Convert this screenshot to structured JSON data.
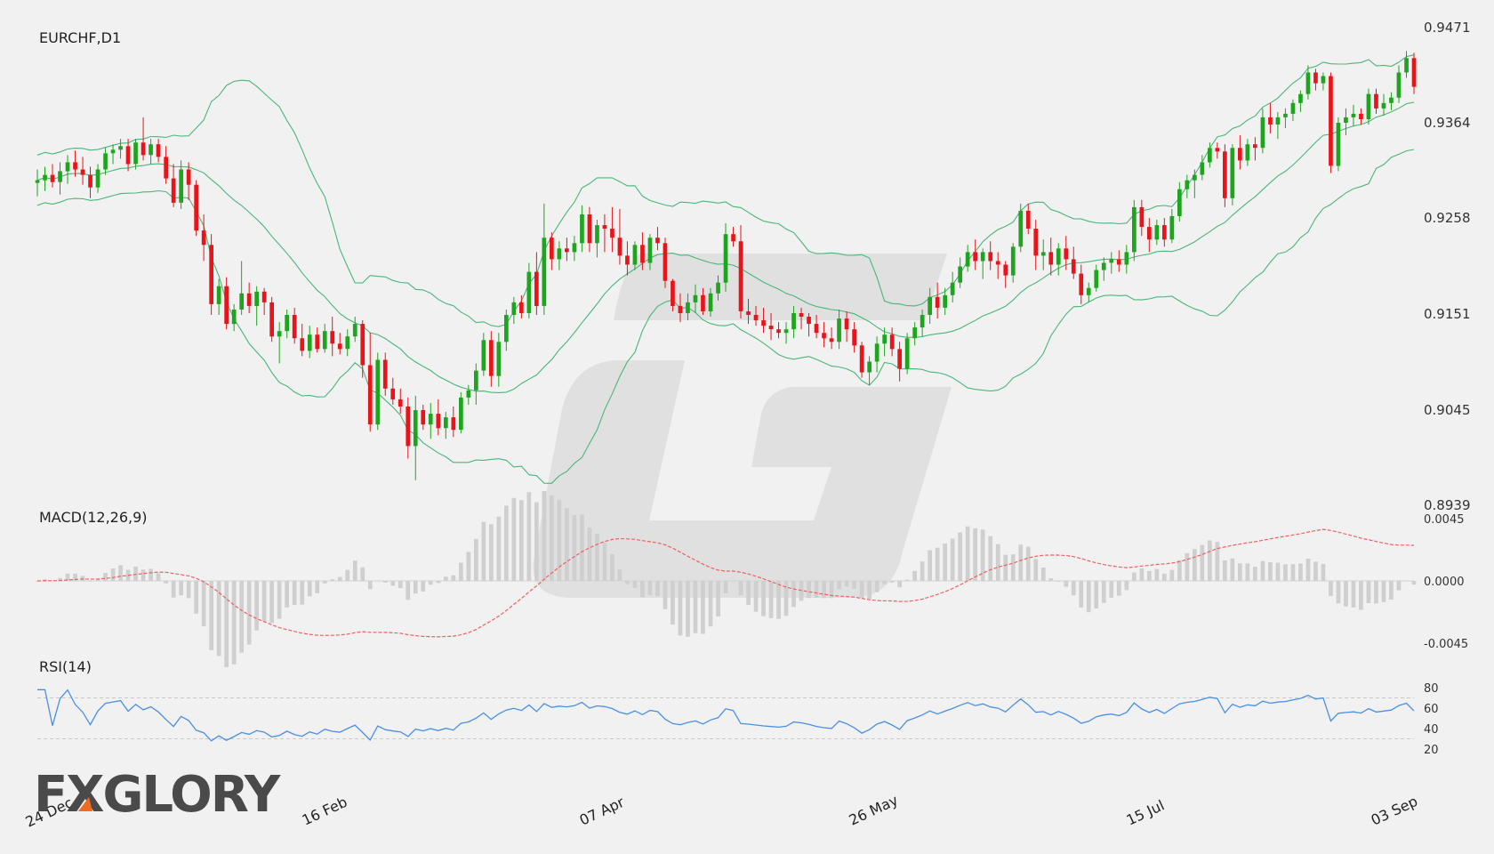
{
  "chart_data": [
    {
      "type": "candlestick",
      "title": "EURCHF,D1",
      "ylim": [
        0.8939,
        0.9471
      ],
      "y_ticks": [
        "0.9471",
        "0.9364",
        "0.9258",
        "0.9151",
        "0.9045",
        "0.8939"
      ],
      "x_tick_labels": [
        "24 Dec",
        "16 Feb",
        "07 Apr",
        "26 May",
        "15 Jul",
        "03 Sep"
      ],
      "bollinger_bands": true,
      "colors": {
        "up": "#1ea51e",
        "down": "#e8141a",
        "band": "#4ab67a"
      },
      "ohlc": [
        [
          0.9297,
          0.9312,
          0.9282,
          0.93
        ],
        [
          0.93,
          0.9315,
          0.9288,
          0.9306
        ],
        [
          0.9306,
          0.9318,
          0.9292,
          0.9298
        ],
        [
          0.9298,
          0.932,
          0.9284,
          0.931
        ],
        [
          0.931,
          0.9328,
          0.9296,
          0.932
        ],
        [
          0.932,
          0.9333,
          0.9304,
          0.9312
        ],
        [
          0.9312,
          0.9326,
          0.9295,
          0.9306
        ],
        [
          0.9306,
          0.9315,
          0.928,
          0.9292
        ],
        [
          0.9292,
          0.9318,
          0.9286,
          0.9312
        ],
        [
          0.9312,
          0.9336,
          0.9306,
          0.933
        ],
        [
          0.933,
          0.934,
          0.9318,
          0.9334
        ],
        [
          0.9334,
          0.9346,
          0.9324,
          0.9338
        ],
        [
          0.9338,
          0.9346,
          0.931,
          0.9318
        ],
        [
          0.9318,
          0.9346,
          0.9312,
          0.9342
        ],
        [
          0.9342,
          0.937,
          0.9322,
          0.9328
        ],
        [
          0.9328,
          0.9346,
          0.9318,
          0.934
        ],
        [
          0.934,
          0.9346,
          0.932,
          0.9326
        ],
        [
          0.9326,
          0.9338,
          0.9296,
          0.9302
        ],
        [
          0.9302,
          0.9318,
          0.927,
          0.9275
        ],
        [
          0.9275,
          0.9322,
          0.9268,
          0.9312
        ],
        [
          0.9312,
          0.932,
          0.9278,
          0.9295
        ],
        [
          0.9295,
          0.93,
          0.9238,
          0.9244
        ],
        [
          0.9244,
          0.9262,
          0.921,
          0.9228
        ],
        [
          0.9228,
          0.924,
          0.915,
          0.9162
        ],
        [
          0.9162,
          0.919,
          0.915,
          0.9182
        ],
        [
          0.9182,
          0.9192,
          0.9134,
          0.914
        ],
        [
          0.914,
          0.9162,
          0.9132,
          0.9156
        ],
        [
          0.9156,
          0.921,
          0.915,
          0.9174
        ],
        [
          0.9174,
          0.9186,
          0.9152,
          0.916
        ],
        [
          0.916,
          0.9182,
          0.9138,
          0.9176
        ],
        [
          0.9176,
          0.918,
          0.915,
          0.9164
        ],
        [
          0.9164,
          0.917,
          0.912,
          0.9126
        ],
        [
          0.9126,
          0.9142,
          0.9096,
          0.9132
        ],
        [
          0.9132,
          0.9156,
          0.9124,
          0.915
        ],
        [
          0.915,
          0.9158,
          0.9118,
          0.9124
        ],
        [
          0.9124,
          0.914,
          0.9104,
          0.911
        ],
        [
          0.911,
          0.9138,
          0.9102,
          0.9128
        ],
        [
          0.9128,
          0.9136,
          0.9108,
          0.9112
        ],
        [
          0.9112,
          0.914,
          0.9108,
          0.9132
        ],
        [
          0.9132,
          0.9148,
          0.9104,
          0.9118
        ],
        [
          0.9118,
          0.913,
          0.9106,
          0.9112
        ],
        [
          0.9112,
          0.9134,
          0.9104,
          0.9126
        ],
        [
          0.9126,
          0.9148,
          0.912,
          0.914
        ],
        [
          0.914,
          0.9144,
          0.908,
          0.9094
        ],
        [
          0.9094,
          0.913,
          0.902,
          0.9028
        ],
        [
          0.9028,
          0.9108,
          0.9022,
          0.91
        ],
        [
          0.91,
          0.9108,
          0.906,
          0.9068
        ],
        [
          0.9068,
          0.908,
          0.905,
          0.9056
        ],
        [
          0.9056,
          0.9068,
          0.904,
          0.9048
        ],
        [
          0.9048,
          0.9058,
          0.899,
          0.9004
        ],
        [
          0.9004,
          0.906,
          0.8966,
          0.9044
        ],
        [
          0.9044,
          0.905,
          0.9022,
          0.9028
        ],
        [
          0.9028,
          0.9052,
          0.9012,
          0.904
        ],
        [
          0.904,
          0.9056,
          0.9016,
          0.9024
        ],
        [
          0.9024,
          0.9042,
          0.9012,
          0.9036
        ],
        [
          0.9036,
          0.9048,
          0.9014,
          0.9022
        ],
        [
          0.9022,
          0.9064,
          0.9018,
          0.9058
        ],
        [
          0.9058,
          0.9072,
          0.905,
          0.9066
        ],
        [
          0.9066,
          0.9096,
          0.905,
          0.9088
        ],
        [
          0.9088,
          0.913,
          0.9082,
          0.9122
        ],
        [
          0.9122,
          0.9132,
          0.907,
          0.9082
        ],
        [
          0.9082,
          0.913,
          0.907,
          0.912
        ],
        [
          0.912,
          0.9156,
          0.911,
          0.915
        ],
        [
          0.915,
          0.917,
          0.914,
          0.9164
        ],
        [
          0.9164,
          0.9172,
          0.9146,
          0.9152
        ],
        [
          0.9152,
          0.9208,
          0.9146,
          0.9198
        ],
        [
          0.9198,
          0.922,
          0.915,
          0.916
        ],
        [
          0.916,
          0.9274,
          0.915,
          0.9236
        ],
        [
          0.9236,
          0.9242,
          0.92,
          0.9212
        ],
        [
          0.9212,
          0.9232,
          0.92,
          0.9224
        ],
        [
          0.9224,
          0.9236,
          0.921,
          0.922
        ],
        [
          0.922,
          0.9238,
          0.921,
          0.923
        ],
        [
          0.923,
          0.9272,
          0.922,
          0.9262
        ],
        [
          0.9262,
          0.927,
          0.922,
          0.923
        ],
        [
          0.923,
          0.9256,
          0.9214,
          0.925
        ],
        [
          0.925,
          0.9262,
          0.922,
          0.9246
        ],
        [
          0.9246,
          0.927,
          0.922,
          0.9236
        ],
        [
          0.9236,
          0.9268,
          0.9206,
          0.9216
        ],
        [
          0.9216,
          0.9232,
          0.9194,
          0.9206
        ],
        [
          0.9206,
          0.9232,
          0.92,
          0.9228
        ],
        [
          0.9228,
          0.9242,
          0.92,
          0.9208
        ],
        [
          0.9208,
          0.924,
          0.92,
          0.9236
        ],
        [
          0.9236,
          0.9248,
          0.9222,
          0.923
        ],
        [
          0.923,
          0.9236,
          0.918,
          0.9188
        ],
        [
          0.9188,
          0.919,
          0.9154,
          0.916
        ],
        [
          0.916,
          0.9174,
          0.9142,
          0.9152
        ],
        [
          0.9152,
          0.9174,
          0.9144,
          0.9164
        ],
        [
          0.9164,
          0.9184,
          0.9152,
          0.9172
        ],
        [
          0.9172,
          0.918,
          0.915,
          0.9154
        ],
        [
          0.9154,
          0.918,
          0.9148,
          0.9174
        ],
        [
          0.9174,
          0.9194,
          0.9166,
          0.9186
        ],
        [
          0.9186,
          0.9252,
          0.9176,
          0.924
        ],
        [
          0.924,
          0.9248,
          0.9226,
          0.9232
        ],
        [
          0.9232,
          0.925,
          0.9146,
          0.9154
        ],
        [
          0.9154,
          0.9168,
          0.914,
          0.915
        ],
        [
          0.915,
          0.916,
          0.9138,
          0.9144
        ],
        [
          0.9144,
          0.9158,
          0.913,
          0.9138
        ],
        [
          0.9138,
          0.9152,
          0.9122,
          0.9134
        ],
        [
          0.9134,
          0.9142,
          0.9124,
          0.913
        ],
        [
          0.913,
          0.9142,
          0.9118,
          0.9134
        ],
        [
          0.9134,
          0.916,
          0.9124,
          0.9152
        ],
        [
          0.9152,
          0.9158,
          0.9134,
          0.9148
        ],
        [
          0.9148,
          0.9152,
          0.9126,
          0.914
        ],
        [
          0.914,
          0.915,
          0.9124,
          0.913
        ],
        [
          0.913,
          0.9142,
          0.9114,
          0.9124
        ],
        [
          0.9124,
          0.9136,
          0.9112,
          0.912
        ],
        [
          0.912,
          0.9156,
          0.9112,
          0.9146
        ],
        [
          0.9146,
          0.9154,
          0.912,
          0.9134
        ],
        [
          0.9134,
          0.9142,
          0.9108,
          0.9116
        ],
        [
          0.9116,
          0.912,
          0.908,
          0.9086
        ],
        [
          0.9086,
          0.9104,
          0.9072,
          0.9098
        ],
        [
          0.9098,
          0.9126,
          0.9086,
          0.9118
        ],
        [
          0.9118,
          0.9136,
          0.9104,
          0.9128
        ],
        [
          0.9128,
          0.9136,
          0.9104,
          0.9112
        ],
        [
          0.9112,
          0.912,
          0.9076,
          0.909
        ],
        [
          0.909,
          0.913,
          0.9084,
          0.9124
        ],
        [
          0.9124,
          0.9142,
          0.9116,
          0.9136
        ],
        [
          0.9136,
          0.9156,
          0.9126,
          0.915
        ],
        [
          0.915,
          0.918,
          0.914,
          0.917
        ],
        [
          0.917,
          0.9186,
          0.9146,
          0.9158
        ],
        [
          0.9158,
          0.918,
          0.915,
          0.9172
        ],
        [
          0.9172,
          0.9198,
          0.9164,
          0.9186
        ],
        [
          0.9186,
          0.9214,
          0.918,
          0.9204
        ],
        [
          0.9204,
          0.9228,
          0.9198,
          0.922
        ],
        [
          0.922,
          0.9234,
          0.92,
          0.921
        ],
        [
          0.921,
          0.9224,
          0.919,
          0.922
        ],
        [
          0.922,
          0.9232,
          0.92,
          0.921
        ],
        [
          0.921,
          0.922,
          0.919,
          0.9206
        ],
        [
          0.9206,
          0.921,
          0.918,
          0.9194
        ],
        [
          0.9194,
          0.923,
          0.9186,
          0.9226
        ],
        [
          0.9226,
          0.9274,
          0.922,
          0.9266
        ],
        [
          0.9266,
          0.9274,
          0.924,
          0.9246
        ],
        [
          0.9246,
          0.9256,
          0.92,
          0.9216
        ],
        [
          0.9216,
          0.9234,
          0.92,
          0.922
        ],
        [
          0.922,
          0.9236,
          0.9194,
          0.9206
        ],
        [
          0.9206,
          0.923,
          0.9194,
          0.9224
        ],
        [
          0.9224,
          0.9238,
          0.92,
          0.9212
        ],
        [
          0.9212,
          0.9226,
          0.919,
          0.9196
        ],
        [
          0.9196,
          0.9206,
          0.9162,
          0.9172
        ],
        [
          0.9172,
          0.9186,
          0.9164,
          0.918
        ],
        [
          0.918,
          0.9206,
          0.9176,
          0.92
        ],
        [
          0.92,
          0.9214,
          0.9188,
          0.9208
        ],
        [
          0.9208,
          0.922,
          0.9196,
          0.9212
        ],
        [
          0.9212,
          0.9222,
          0.9198,
          0.9206
        ],
        [
          0.9206,
          0.9228,
          0.9196,
          0.922
        ],
        [
          0.922,
          0.9278,
          0.921,
          0.927
        ],
        [
          0.927,
          0.9278,
          0.9238,
          0.9248
        ],
        [
          0.9248,
          0.9258,
          0.922,
          0.9234
        ],
        [
          0.9234,
          0.9256,
          0.9228,
          0.925
        ],
        [
          0.925,
          0.9258,
          0.9226,
          0.9234
        ],
        [
          0.9234,
          0.9268,
          0.923,
          0.926
        ],
        [
          0.926,
          0.9298,
          0.9254,
          0.929
        ],
        [
          0.929,
          0.9306,
          0.928,
          0.93
        ],
        [
          0.93,
          0.9312,
          0.928,
          0.9306
        ],
        [
          0.9306,
          0.9328,
          0.93,
          0.932
        ],
        [
          0.932,
          0.9342,
          0.9314,
          0.9336
        ],
        [
          0.9336,
          0.9342,
          0.9324,
          0.9332
        ],
        [
          0.9332,
          0.934,
          0.927,
          0.928
        ],
        [
          0.928,
          0.934,
          0.9272,
          0.9336
        ],
        [
          0.9336,
          0.935,
          0.9312,
          0.9322
        ],
        [
          0.9322,
          0.9346,
          0.9316,
          0.934
        ],
        [
          0.934,
          0.9348,
          0.9322,
          0.9336
        ],
        [
          0.9336,
          0.938,
          0.933,
          0.937
        ],
        [
          0.937,
          0.9386,
          0.9352,
          0.9362
        ],
        [
          0.9362,
          0.9376,
          0.9346,
          0.937
        ],
        [
          0.937,
          0.938,
          0.9358,
          0.9374
        ],
        [
          0.9374,
          0.939,
          0.9366,
          0.9386
        ],
        [
          0.9386,
          0.94,
          0.9376,
          0.9396
        ],
        [
          0.9396,
          0.9428,
          0.939,
          0.942
        ],
        [
          0.942,
          0.9424,
          0.94,
          0.9408
        ],
        [
          0.9408,
          0.942,
          0.94,
          0.9416
        ],
        [
          0.9416,
          0.942,
          0.9308,
          0.9316
        ],
        [
          0.9316,
          0.937,
          0.931,
          0.9364
        ],
        [
          0.9364,
          0.938,
          0.935,
          0.937
        ],
        [
          0.937,
          0.9384,
          0.936,
          0.9374
        ],
        [
          0.9374,
          0.938,
          0.9362,
          0.9368
        ],
        [
          0.9368,
          0.9402,
          0.9362,
          0.9396
        ],
        [
          0.9396,
          0.9402,
          0.9374,
          0.938
        ],
        [
          0.938,
          0.9396,
          0.9372,
          0.9386
        ],
        [
          0.9386,
          0.9398,
          0.9378,
          0.9392
        ],
        [
          0.9392,
          0.9428,
          0.9386,
          0.942
        ],
        [
          0.942,
          0.9444,
          0.9414,
          0.9436
        ],
        [
          0.9436,
          0.9442,
          0.9396,
          0.9404
        ]
      ]
    },
    {
      "type": "histogram-line",
      "title": "MACD(12,26,9)",
      "ylim": [
        -0.0045,
        0.0045
      ],
      "y_ticks": [
        "0.0045",
        "0.0000",
        "-0.0045"
      ],
      "colors": {
        "histogram": "#cfcfcf",
        "signal": "#f06060"
      }
    },
    {
      "type": "line",
      "title": "RSI(14)",
      "ylim": [
        20,
        80
      ],
      "y_ticks": [
        "80",
        "60",
        "40",
        "20"
      ],
      "levels": [
        70,
        30
      ],
      "colors": {
        "line": "#4a90e2",
        "level": "#c9c9c9"
      }
    }
  ],
  "logo": {
    "prefix": "F",
    "middle": "X",
    "suffix": "GLORY",
    "accent": "#f06a22"
  }
}
